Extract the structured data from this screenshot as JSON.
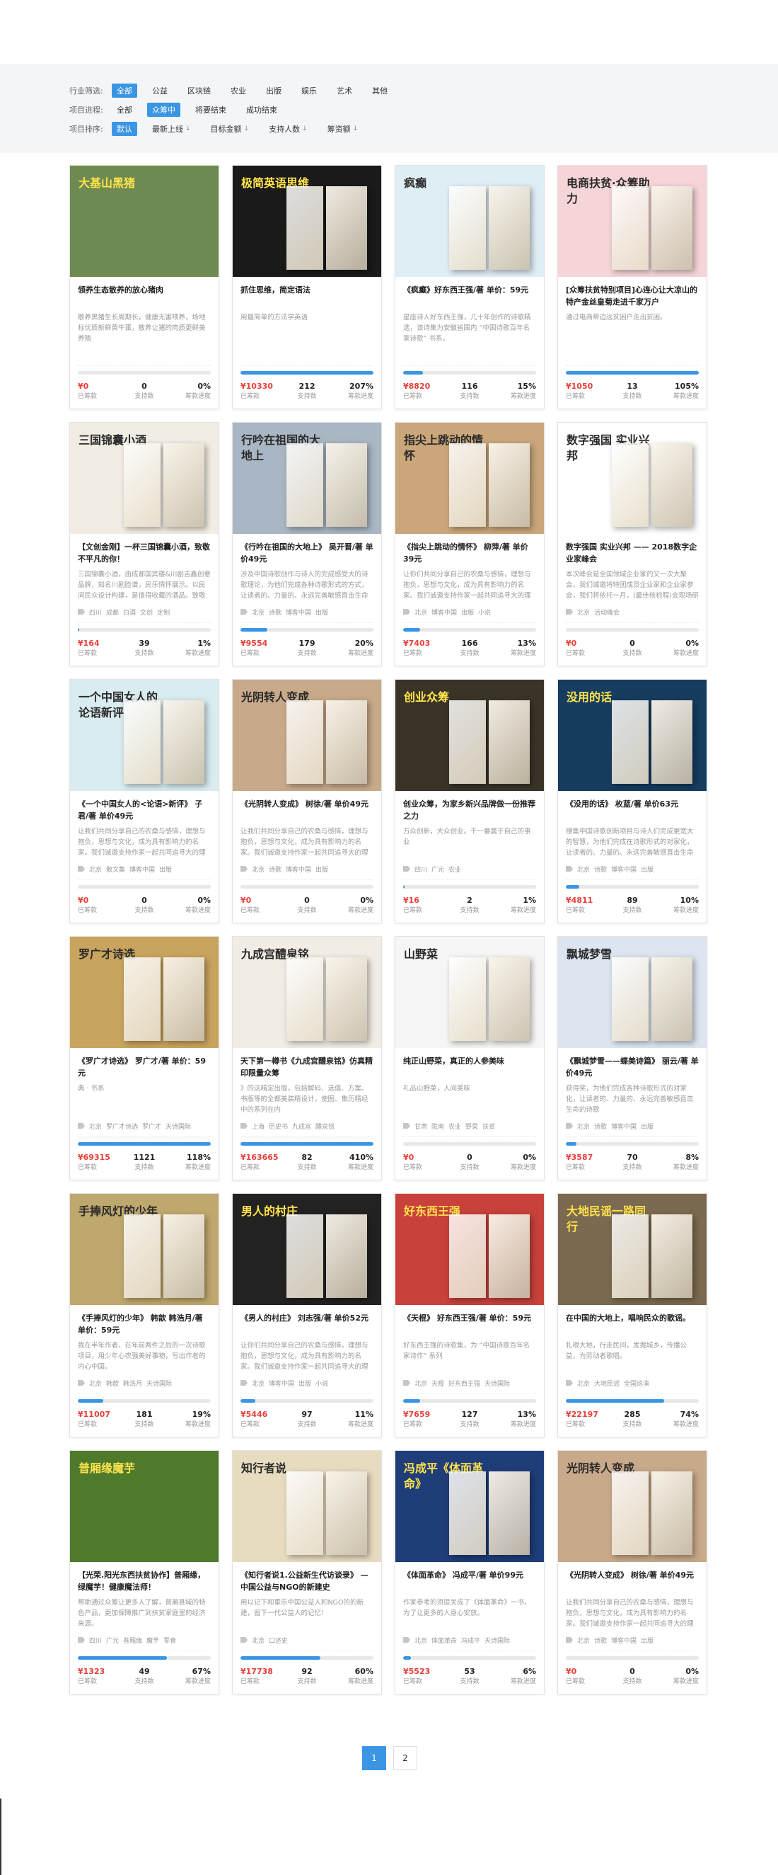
{
  "filters": {
    "industry": {
      "label": "行业筛选:",
      "options": [
        "全部",
        "公益",
        "区块链",
        "农业",
        "出版",
        "娱乐",
        "艺术",
        "其他"
      ],
      "active": 0
    },
    "progress": {
      "label": "项目进程:",
      "options": [
        "全部",
        "众筹中",
        "将要结束",
        "成功结束"
      ],
      "active": 1
    },
    "sort": {
      "label": "项目排序:",
      "options": [
        "默认",
        "最新上线",
        "目标金额",
        "支持人数",
        "筹资额"
      ],
      "active": 0
    }
  },
  "stat_labels": {
    "raised": "已筹款",
    "backers": "支持数",
    "progress": "筹款进度"
  },
  "projects": [
    {
      "title": "领养生态散养的放心猪肉",
      "desc": "散养黑猪生长周期长，健康无害喂养，场地标优质新鲜黄牛蛋，散养让猪的肉质更鲜美养殖",
      "tags": [],
      "raised": "¥0",
      "backers": "0",
      "progress": "0%",
      "pct": 0,
      "img_label": "大基山黑猪",
      "bg": "#6f8a50"
    },
    {
      "title": "抓住思维，简定语法",
      "desc": "用最简单的方法学英语",
      "tags": [],
      "raised": "¥10330",
      "backers": "212",
      "progress": "207%",
      "pct": 100,
      "img_label": "极简英语思维",
      "bg": "#1a1a1a"
    },
    {
      "title": "《疯癫》好东西王强/著 单价：59元",
      "desc": "星座诗人好东西王强，几十年创作的诗歌精选，该诗集为安徽省国内 “中国诗歌百年名家诗歌” 书系。",
      "tags": [],
      "raised": "¥8820",
      "backers": "116",
      "progress": "15%",
      "pct": 15,
      "img_label": "疯癫",
      "bg": "#dfeef5"
    },
    {
      "title": "[众筹扶贫特别项目]心连心让大凉山的特产金丝皇菊走进千家万户",
      "desc": "通过电商帮边远贫困户走出贫困。",
      "tags": [],
      "raised": "¥1050",
      "backers": "13",
      "progress": "105%",
      "pct": 100,
      "img_label": "电商扶贫·众筹助力",
      "bg": "#f6d5d8"
    },
    {
      "title": "【文创金刚】一杯三国锦囊小酒，致敬不平凡的你！",
      "desc": "三国锦囊小酒，由成都国宾楼&川剧吉鑫创意品牌，知名川剧脸谱，民乐情怀展示。以民间民众设计构建，是值得收藏的酒品。致敬一杯好酒",
      "tags": [
        "四川",
        "成都",
        "白酒",
        "文创",
        "定制"
      ],
      "raised": "¥164",
      "backers": "39",
      "progress": "1%",
      "pct": 1,
      "img_label": "三国锦囊小酒",
      "bg": "#f2ede4"
    },
    {
      "title": "《行吟在祖国的大地上》 吴开晋/著 单价49元",
      "desc": "涉及中国诗歌创作与诗人的完成感受大的诗歌理论，为他们完成各种诗歌形式的方式，让读者的、力量的、永远完善敏感直击生命的诗歌",
      "tags": [
        "北京",
        "诗歌",
        "博客中国",
        "出版"
      ],
      "raised": "¥9554",
      "backers": "179",
      "progress": "20%",
      "pct": 20,
      "img_label": "行吟在祖国的大地上",
      "bg": "#a9b6c3"
    },
    {
      "title": "《指尖上跳动的情怀》 柳萍/著 单价39元",
      "desc": "让你们共同分享自己的农桑与感情，理想与抱负，思想与文化，成为具有影响力的名家。我们诚邀支持作家一起共同追寻大的理想，创建",
      "tags": [
        "北京",
        "博客中国",
        "出版",
        "小说"
      ],
      "raised": "¥7403",
      "backers": "166",
      "progress": "13%",
      "pct": 13,
      "img_label": "指尖上跳动的情怀",
      "bg": "#caa67a"
    },
    {
      "title": "数字强国 实业兴邦 —— 2018数字企业家峰会",
      "desc": "本次峰会是全国领域企业家的又一次大聚会，我们诚邀将特团成员企业家和企业家参会，我们将依托一月，(最佳核检程)会现场研讨企业研究的发展",
      "tags": [
        "北京",
        "活动峰会"
      ],
      "raised": "¥0",
      "backers": "0",
      "progress": "0%",
      "pct": 0,
      "img_label": "数字强国 实业兴邦",
      "bg": "#ffffff"
    },
    {
      "title": "《一个中国女人的<论语>新评》 子君/著 单价49元",
      "desc": "让我们共同分享自己的农桑与感情，理想与抱负，思想与文化，成为具有影响力的名家。我们诚邀支持作家一起共同追寻大的理想，创建",
      "tags": [
        "北京",
        "散文集",
        "博客中国",
        "出版"
      ],
      "raised": "¥0",
      "backers": "0",
      "progress": "0%",
      "pct": 0,
      "img_label": "一个中国女人的论语新评",
      "bg": "#d9ecf0"
    },
    {
      "title": "《光阴转人变成》 树徐/著 单价49元",
      "desc": "让我们共同分享自己的农桑与感情，理想与抱负，思想与文化，成为具有影响力的名家。我们诚邀支持作家一起共同追寻大的理想，创建",
      "tags": [
        "北京",
        "诗歌",
        "博客中国",
        "出版"
      ],
      "raised": "¥0",
      "backers": "0",
      "progress": "0%",
      "pct": 0,
      "img_label": "光阴转人变成",
      "bg": "#c8a98a"
    },
    {
      "title": "创业众筹，为家乡新兴品牌做一份推荐之力",
      "desc": "万众创新，大众创业。千一番属于自己的事业",
      "tags": [
        "四川",
        "广元",
        "农业"
      ],
      "raised": "¥16",
      "backers": "2",
      "progress": "1%",
      "pct": 1,
      "img_label": "创业众筹",
      "bg": "#3a3428"
    },
    {
      "title": "《没用的话》 枚蓝/著 单价63元",
      "desc": "搜集中国诗歌创新项目与诗人们完成更宽大的智慧，为他们完成在诗歌形式的对家化，让读者的、力量的、永远完善敏感直击生命的诗歌",
      "tags": [
        "北京",
        "诗歌",
        "博客中国",
        "出版"
      ],
      "raised": "¥4811",
      "backers": "89",
      "progress": "10%",
      "pct": 10,
      "img_label": "没用的话",
      "bg": "#163c60"
    },
    {
      "title": "《罗广才诗选》 罗广才/著 单价：59元",
      "desc": "典 · 书系",
      "tags": [
        "北京",
        "罗广才诗选",
        "罗广才",
        "天诗国际"
      ],
      "raised": "¥69315",
      "backers": "1121",
      "progress": "118%",
      "pct": 100,
      "img_label": "罗广才诗选",
      "bg": "#c9a45e"
    },
    {
      "title": "天下第一樽书《九成宫醴泉铭》仿真精印限量众筹",
      "desc": "》的这精定出版，包括解码、选值、方案、书版等的全都美装精设计，使图、集历精经中的系列在内",
      "tags": [
        "上海",
        "历史书",
        "九成宫",
        "醴泉铭"
      ],
      "raised": "¥163665",
      "backers": "82",
      "progress": "410%",
      "pct": 100,
      "img_label": "九成宫醴泉铭",
      "bg": "#f1ede5"
    },
    {
      "title": "纯正山野菜，真正的人参美味",
      "desc": "礼品山野菜，人间美味",
      "tags": [
        "甘肃",
        "陇南",
        "农业",
        "野菜",
        "扶贫"
      ],
      "raised": "¥0",
      "backers": "0",
      "progress": "0%",
      "pct": 0,
      "img_label": "山野菜",
      "bg": "#f6f6f6"
    },
    {
      "title": "《飘城梦雪——蝶美诗篇》 丽云/著 单价49元",
      "desc": "获得奖，为他们完成各种诗歌形式的对家化，让读者的、力量的、永远完善敏感直击生命的诗歌",
      "tags": [
        "北京",
        "诗歌",
        "博客中国",
        "出版"
      ],
      "raised": "¥3587",
      "backers": "70",
      "progress": "8%",
      "pct": 8,
      "img_label": "飘城梦雪",
      "bg": "#dce5f0"
    },
    {
      "title": "《手捧风灯的少年》 韩歆 韩浩月/著 单价：59元",
      "desc": "我在半年作者，在年前两件之后的一次诗歌项目，用少年心农强美好事物，写出作者的内心中国。",
      "tags": [
        "北京",
        "韩歆",
        "韩浩月",
        "天诗国际"
      ],
      "raised": "¥11007",
      "backers": "181",
      "progress": "19%",
      "pct": 19,
      "img_label": "手捧风灯的少年",
      "bg": "#bfa86e"
    },
    {
      "title": "《男人的村庄》 刘志强/著 单价52元",
      "desc": "让你们共同分享自己的农桑与感情，理想与抱负，思想与文化，成为具有影响力的名家。我们诚邀支持作家一起共同追寻大的理想，创建",
      "tags": [
        "北京",
        "博客中国",
        "出版",
        "小说"
      ],
      "raised": "¥5446",
      "backers": "97",
      "progress": "11%",
      "pct": 11,
      "img_label": "男人的村庄",
      "bg": "#222222"
    },
    {
      "title": "《天棍》 好东西王强/著 单价：59元",
      "desc": "好东西王强的诗歌集，为 “中国诗歌百年名家诗作” 系列",
      "tags": [
        "北京",
        "天棍",
        "好东西王强",
        "天诗国际"
      ],
      "raised": "¥7659",
      "backers": "127",
      "progress": "13%",
      "pct": 13,
      "img_label": "好东西王强",
      "bg": "#c8413b"
    },
    {
      "title": "在中国的大地上，唱响民众的歌谣。",
      "desc": "扎根大地，行走民间，发掘城乡，传播公益，为劳动者歌唱。",
      "tags": [
        "北京",
        "大地民谣",
        "全国巡演"
      ],
      "raised": "¥22197",
      "backers": "285",
      "progress": "74%",
      "pct": 74,
      "img_label": "大地民谣一路同行",
      "bg": "#7b6a4f"
    },
    {
      "title": "【光荣.阳光东西扶贫协作】普厢缘，绿魔芋！健康魔法师！",
      "desc": "帮助通过众筹让更多人了解，普厢县域的特色产品，更加保障推广到扶贫家庭里的经济来源。",
      "tags": [
        "四川",
        "广元",
        "普厢缘",
        "魔芋",
        "零食"
      ],
      "raised": "¥1323",
      "backers": "49",
      "progress": "67%",
      "pct": 67,
      "img_label": "普厢缘魔芋",
      "bg": "#4f7a2b"
    },
    {
      "title": "《知行者说1.公益新生代访谈录》 — 中国公益与NGO的新建史",
      "desc": "用以记下和重乐中国公益人和NGO的的新建，留下一代公益人的记忆！",
      "tags": [
        "北京",
        "口述史"
      ],
      "raised": "¥17738",
      "backers": "92",
      "progress": "60%",
      "pct": 60,
      "img_label": "知行者说",
      "bg": "#e8dcc0"
    },
    {
      "title": "《体面革命》 冯成平/著 单价99元",
      "desc": "作家参考的须提关成了《体面革命》一书，为了让更多的人身心安放。",
      "tags": [
        "北京",
        "体面革命",
        "冯成平",
        "天诗国际"
      ],
      "raised": "¥5523",
      "backers": "53",
      "progress": "6%",
      "pct": 6,
      "img_label": "冯成平《体面革命》",
      "bg": "#1f3d79"
    },
    {
      "title": "《光阴转人变成》 树徐/著 单价49元",
      "desc": "让我们共同分享自己的农桑与感情，理想与抱负，思想与文化，成为具有影响力的名家。我们诚邀支持作家一起共同追寻大的理想，创建",
      "tags": [
        "北京",
        "诗歌",
        "博客中国",
        "出版"
      ],
      "raised": "¥0",
      "backers": "0",
      "progress": "0%",
      "pct": 0,
      "img_label": "光阴转人变成",
      "bg": "#c8a98a"
    }
  ],
  "pagination": {
    "pages": [
      "1",
      "2"
    ],
    "active": 0
  }
}
